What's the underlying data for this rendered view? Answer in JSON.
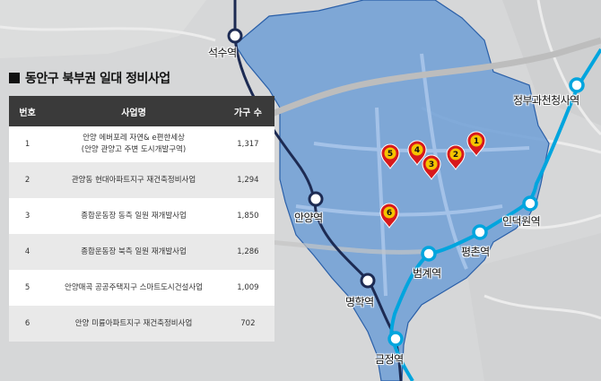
{
  "title": "동안구 북부권 일대 정비사업",
  "table": {
    "headers": [
      "번호",
      "사업명",
      "가구 수"
    ],
    "rows": [
      {
        "no": "1",
        "name_line1": "안양 에버포레 자연& e편한세상",
        "name_line2": "(안양 관양고 주변 도시개발구역)",
        "households": "1,317"
      },
      {
        "no": "2",
        "name_line1": "관양동 현대아파트지구 재건축정비사업",
        "name_line2": "",
        "households": "1,294"
      },
      {
        "no": "3",
        "name_line1": "종합운동장 동측 일원 재개발사업",
        "name_line2": "",
        "households": "1,850"
      },
      {
        "no": "4",
        "name_line1": "종합운동장 북측 일원 재개발사업",
        "name_line2": "",
        "households": "1,286"
      },
      {
        "no": "5",
        "name_line1": "안양매곡 공공주택지구 스마트도시건설사업",
        "name_line2": "",
        "households": "1,009"
      },
      {
        "no": "6",
        "name_line1": "안양 미륭아파트지구 재건축정비사업",
        "name_line2": "",
        "households": "702"
      }
    ]
  },
  "stations": {
    "seoksu": "석수역",
    "anyang": "안양역",
    "myeonghak": "명학역",
    "geumjeong": "금정역",
    "beomgye": "범계역",
    "pyeongchon": "평촌역",
    "indeogwon": "인덕원역",
    "jeongbu": "정부과천청사역"
  },
  "markers": [
    "1",
    "2",
    "3",
    "4",
    "5",
    "6"
  ],
  "colors": {
    "district_fill": "#6f9fd6",
    "line_blue": "#00a5de",
    "line_navy": "#1d2b53",
    "marker_red": "#d7191c",
    "marker_yellow": "#f5c400"
  }
}
